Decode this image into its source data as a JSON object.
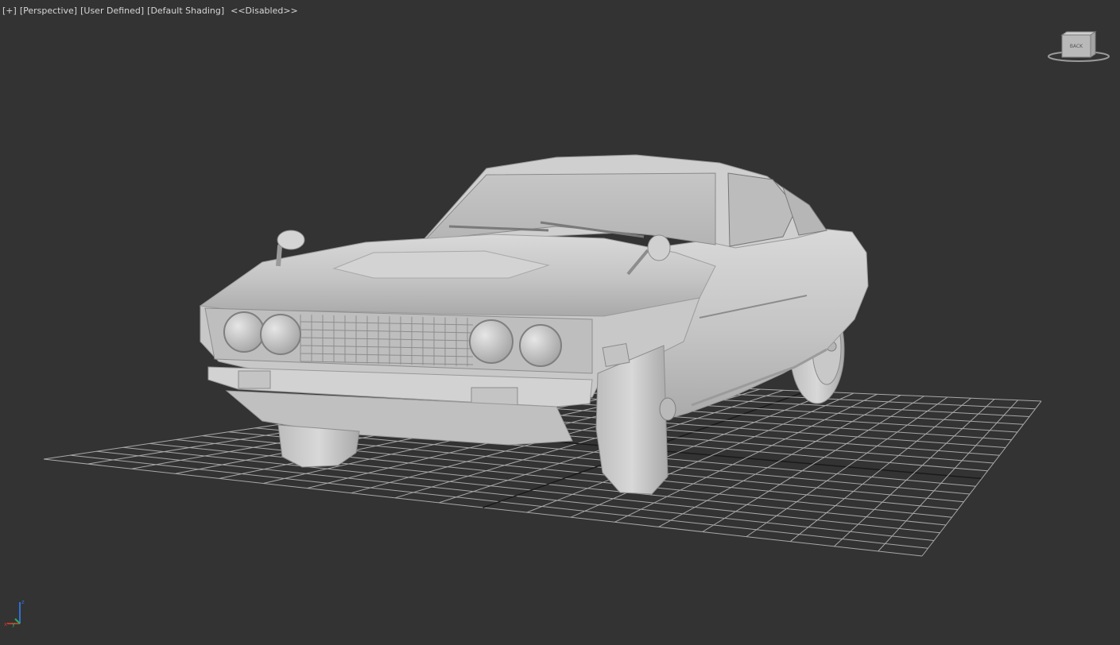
{
  "viewport": {
    "labels": {
      "plus": "[+]",
      "view": "[Perspective]",
      "camera": "[User Defined]",
      "shading": "[Default Shading]",
      "status": "<<Disabled>>"
    },
    "viewcube": {
      "face_label": "BACK"
    },
    "axis_tripod": {
      "x": "x",
      "y": "y",
      "z": "z"
    },
    "colors": {
      "background": "#333333",
      "grid": "#a8a8a8",
      "grid_axis": "#1a1a1a",
      "model": "#c9c9c9",
      "axis_x": "#c0392b",
      "axis_y": "#27ae60",
      "axis_z": "#2f6fd6"
    }
  }
}
